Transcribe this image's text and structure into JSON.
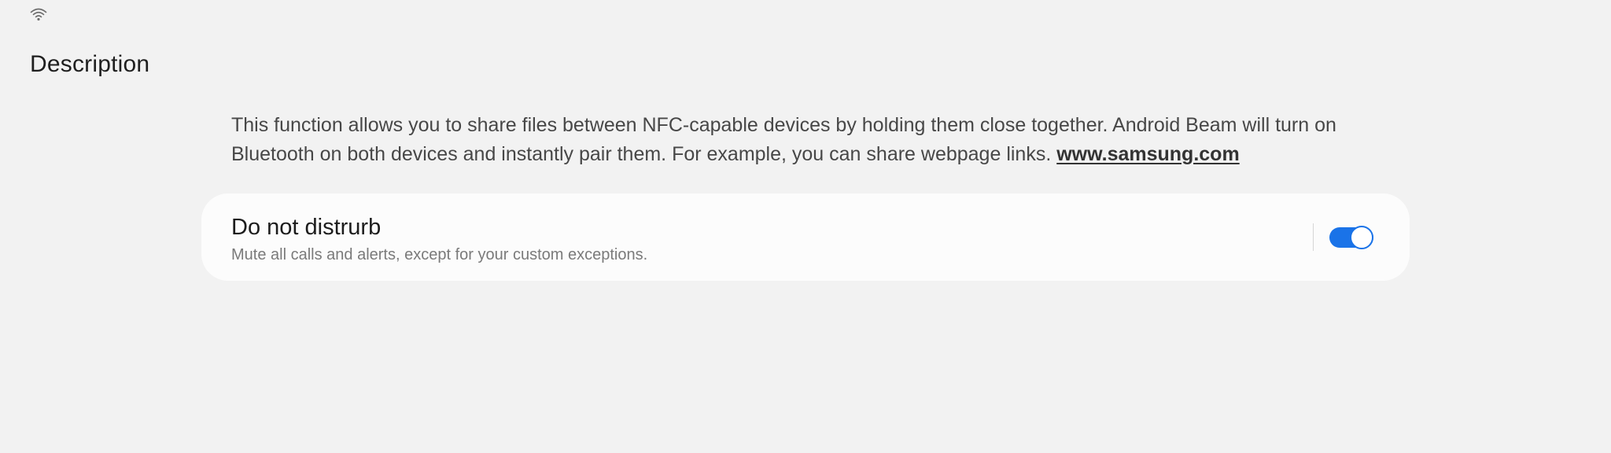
{
  "status_bar": {
    "icons": [
      "wifi-icon"
    ]
  },
  "page": {
    "title": "Description"
  },
  "description": {
    "text": "This function allows you to share files between NFC-capable devices by holding them close together. Android Beam will  turn on Bluetooth on both devices and instantly pair them. For example, you can share webpage links. ",
    "link_text": "www.samsung.com"
  },
  "setting": {
    "title": "Do not distrurb",
    "subtitle": "Mute all calls and alerts, except for your custom exceptions.",
    "toggle_state": "on"
  },
  "colors": {
    "background": "#f2f2f2",
    "card": "#fcfcfc",
    "accent": "#1a73e8"
  }
}
